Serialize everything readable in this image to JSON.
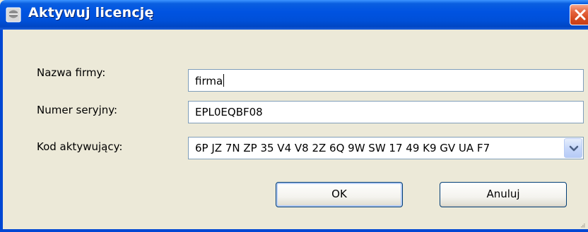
{
  "window": {
    "title": "Aktywuj licencję",
    "icon": "window-app-icon"
  },
  "form": {
    "company_label": "Nazwa firmy:",
    "company_value": "firma",
    "serial_label": "Numer seryjny:",
    "serial_value": "EPL0EQBF08",
    "activation_label": "Kod aktywujący:",
    "activation_value": "6P JZ 7N ZP 35 V4 V8 2Z 6Q 9W SW 17 49 K9 GV UA F7"
  },
  "buttons": {
    "ok_label": "OK",
    "cancel_label": "Anuluj"
  },
  "colors": {
    "titlebar": "#0053e1",
    "close": "#d54a1f",
    "dialog_bg": "#ece9d8",
    "field_border": "#7f9db9"
  }
}
